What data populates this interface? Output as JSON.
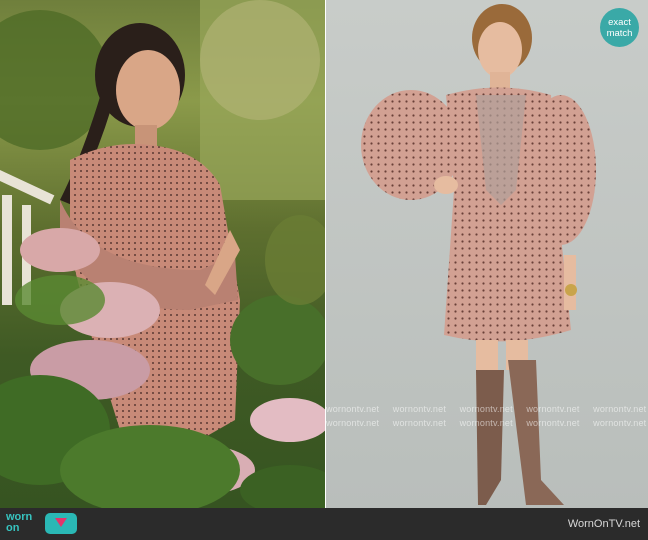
{
  "badge": {
    "line1": "exact",
    "line2": "match"
  },
  "watermark": {
    "row_left": "wornontv.net",
    "rows": [
      [
        "wornontv.net",
        "wornontv.net",
        "wornontv.net",
        "wornontv.net",
        "wornontv.net"
      ],
      [
        "wornontv.net",
        "wornontv.net",
        "wornontv.net",
        "wornontv.net",
        "wornontv.net"
      ]
    ]
  },
  "footer": {
    "logo_word1": "worn",
    "logo_word2": "on",
    "site": "WornOnTV.net"
  },
  "colors": {
    "accent": "#3aa9a7",
    "footer_bg": "#2b2b2b",
    "logo_pink": "#e2356b"
  }
}
